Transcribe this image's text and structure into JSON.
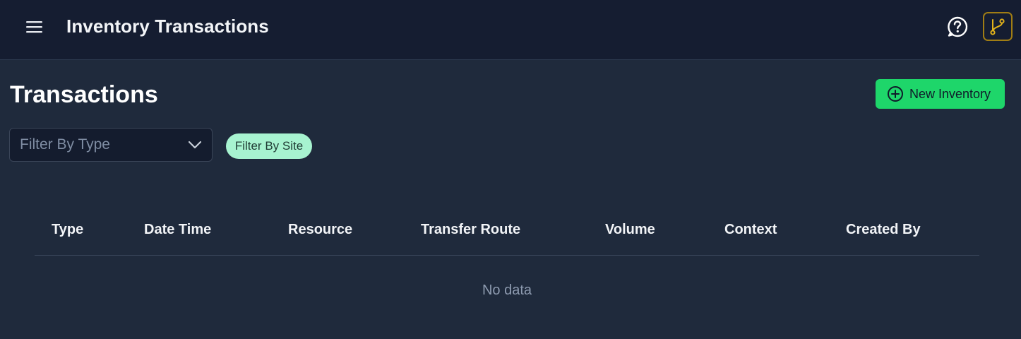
{
  "header": {
    "title": "Inventory Transactions",
    "menu_icon": "hamburger-menu-icon",
    "help_icon": "help-circle-icon",
    "branch_icon": "git-branch-icon"
  },
  "page": {
    "heading": "Transactions",
    "new_button_label": "New Inventory",
    "new_button_icon": "plus-circle-icon"
  },
  "filters": {
    "type_placeholder": "Filter By Type",
    "site_label": "Filter By Site"
  },
  "table": {
    "columns": [
      "Type",
      "Date Time",
      "Resource",
      "Transfer Route",
      "Volume",
      "Context",
      "Created By"
    ],
    "empty_text": "No data"
  },
  "colors": {
    "topbar_bg": "#151d31",
    "page_bg": "#1f2a3c",
    "accent_green": "#1ed66a",
    "chip_bg": "#a7f3d0",
    "branch_border": "#a07d14"
  }
}
